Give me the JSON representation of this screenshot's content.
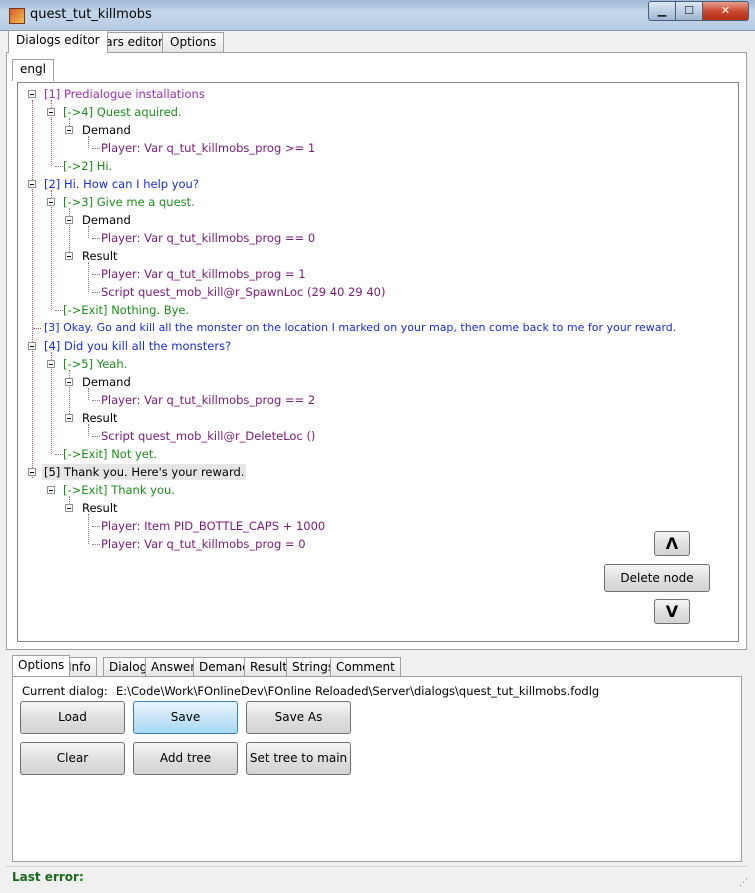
{
  "window": {
    "title": "quest_tut_killmobs"
  },
  "main_tabs": [
    "Dialogs editor",
    "Vars editor",
    "Options"
  ],
  "lang_tab": "engl",
  "tree": [
    {
      "text": "[1] Predialogue installations",
      "color": "purple"
    },
    {
      "text": "[->4] Quest aquired.",
      "color": "green"
    },
    {
      "text": "Demand",
      "color": "black"
    },
    {
      "text": "Player: Var q_tut_killmobs_prog >= 1",
      "color": "darkpurple"
    },
    {
      "text": "[->2] Hi.",
      "color": "green"
    },
    {
      "text": "[2] Hi. How can I help you?",
      "color": "blue"
    },
    {
      "text": "[->3] Give me a quest.",
      "color": "green"
    },
    {
      "text": "Demand",
      "color": "black"
    },
    {
      "text": "Player: Var q_tut_killmobs_prog == 0",
      "color": "darkpurple"
    },
    {
      "text": "Result",
      "color": "black"
    },
    {
      "text": "Player: Var q_tut_killmobs_prog = 1",
      "color": "darkpurple"
    },
    {
      "text": "Script quest_mob_kill@r_SpawnLoc (29 40 29 40)",
      "color": "darkpurple"
    },
    {
      "text": "[->Exit] Nothing. Bye.",
      "color": "green"
    },
    {
      "text": "[3] Okay. Go and kill all the monster on the location I marked on your map, then come back to me for your reward.",
      "color": "blue"
    },
    {
      "text": "[4] Did you kill all the monsters?",
      "color": "blue"
    },
    {
      "text": "[->5] Yeah.",
      "color": "green"
    },
    {
      "text": "Demand",
      "color": "black"
    },
    {
      "text": "Player: Var q_tut_killmobs_prog == 2",
      "color": "darkpurple"
    },
    {
      "text": "Result",
      "color": "black"
    },
    {
      "text": "Script quest_mob_kill@r_DeleteLoc ()",
      "color": "darkpurple"
    },
    {
      "text": "[->Exit] Not yet.",
      "color": "green"
    },
    {
      "text": "[5] Thank you. Here's your reward.",
      "color": "black"
    },
    {
      "text": "[->Exit] Thank you.",
      "color": "green"
    },
    {
      "text": "Result",
      "color": "black"
    },
    {
      "text": "Player: Item PID_BOTTLE_CAPS + 1000",
      "color": "darkpurple"
    },
    {
      "text": "Player: Var q_tut_killmobs_prog = 0",
      "color": "darkpurple"
    }
  ],
  "node_buttons": {
    "up": "Λ",
    "delete": "Delete node",
    "down": "V"
  },
  "sub_tabs": [
    "Options",
    "Info",
    "Dialog",
    "Answer",
    "Demand",
    "Result",
    "Strings",
    "Comment"
  ],
  "current_dialog": {
    "label": "Current dialog:",
    "path": "E:\\Code\\Work\\FOnlineDev\\FOnline Reloaded\\Server\\dialogs\\quest_tut_killmobs.fodlg"
  },
  "buttons": {
    "load": "Load",
    "save": "Save",
    "save_as": "Save As",
    "clear": "Clear",
    "add_tree": "Add tree",
    "set_tree_main": "Set tree to main"
  },
  "status": {
    "last_error": "Last error:"
  },
  "colors": {
    "purple": "#9b2fb0",
    "green": "#1a8f1a",
    "blue": "#1a2dd6",
    "status_green": "#1a6a1a"
  }
}
